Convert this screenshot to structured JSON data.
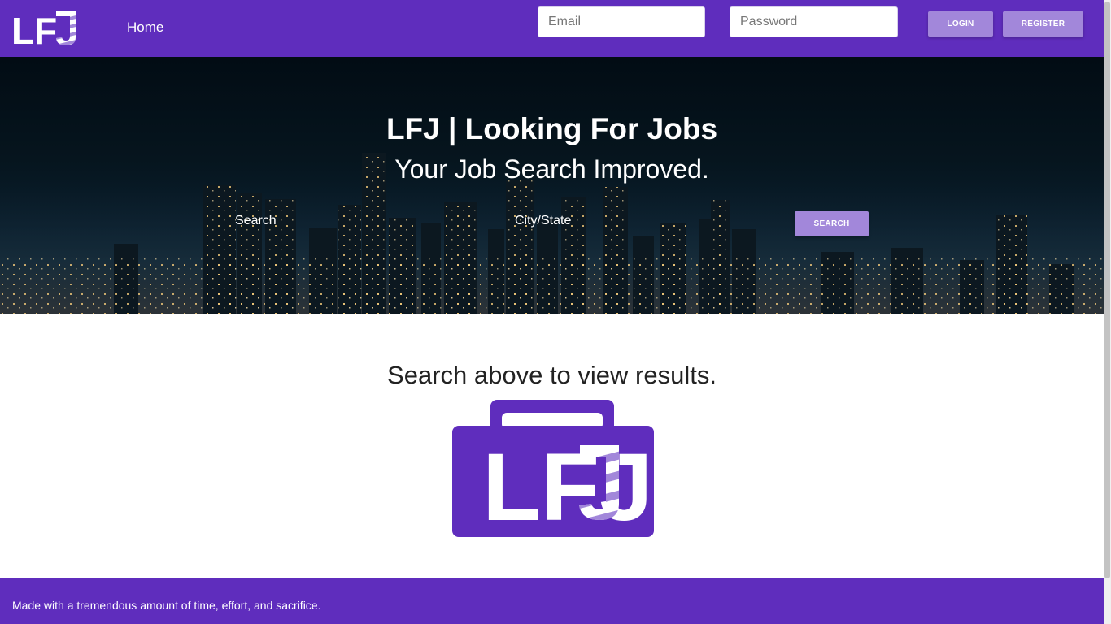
{
  "nav": {
    "logo_text": "LFJ",
    "home_label": "Home",
    "email_placeholder": "Email",
    "password_placeholder": "Password",
    "login_label": "LOGIN",
    "register_label": "REGISTER"
  },
  "hero": {
    "title": "LFJ | Looking For Jobs",
    "subtitle": "Your Job Search Improved.",
    "search_placeholder": "Search",
    "city_placeholder": "City/State",
    "search_button": "SEARCH"
  },
  "main": {
    "results_heading": "Search above to view results.",
    "logo_text": "LFJ"
  },
  "footer": {
    "text": "Made with a tremendous amount of time, effort, and sacrifice."
  },
  "colors": {
    "brand_purple": "#5f2dbd",
    "button_lavender": "#a287da",
    "hero_dark": "#06151e"
  }
}
